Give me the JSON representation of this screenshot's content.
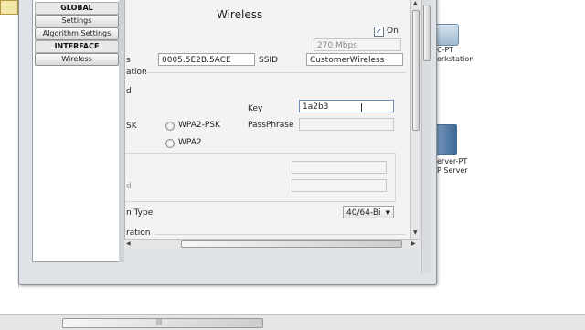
{
  "sidebar": {
    "global_header": "GLOBAL",
    "settings": "Settings",
    "algorithm_settings": "Algorithm Settings",
    "interface_header": "INTERFACE",
    "wireless": "Wireless"
  },
  "panel": {
    "title": "Wireless",
    "port_status_label": "On",
    "port_status_checked": true,
    "bandwidth_value": "270 Mbps",
    "mac_label_partial": "s",
    "mac_value": "0005.5E2B.5ACE",
    "ssid_label": "SSID",
    "ssid_value": "CustomerWireless",
    "auth_section_partial": "ation",
    "auth_disabled_partial": "d",
    "key_label": "Key",
    "key_value": "1a2b3",
    "psk_partial": "SK",
    "wpa2_psk_label": "WPA2-PSK",
    "passphrase_label": "PassPhrase",
    "passphrase_value": "",
    "wpa2_label": "WPA2",
    "blank_field_1": "",
    "blank_field_2": "",
    "ip_partial": "d",
    "encryption_type_partial": "n Type",
    "encryption_type_value": "40/64-Bi",
    "ip_config_partial": "ration"
  },
  "workspace": {
    "device1_label_line1": "C-PT",
    "device1_label_line2": "orkstation",
    "device2_label_line1": "erver-PT",
    "device2_label_line2": "P Server"
  },
  "colors": {
    "dialog_bg": "#dfe3e7",
    "content_bg": "#f3f3f3",
    "field_border": "#9ca4ab"
  }
}
